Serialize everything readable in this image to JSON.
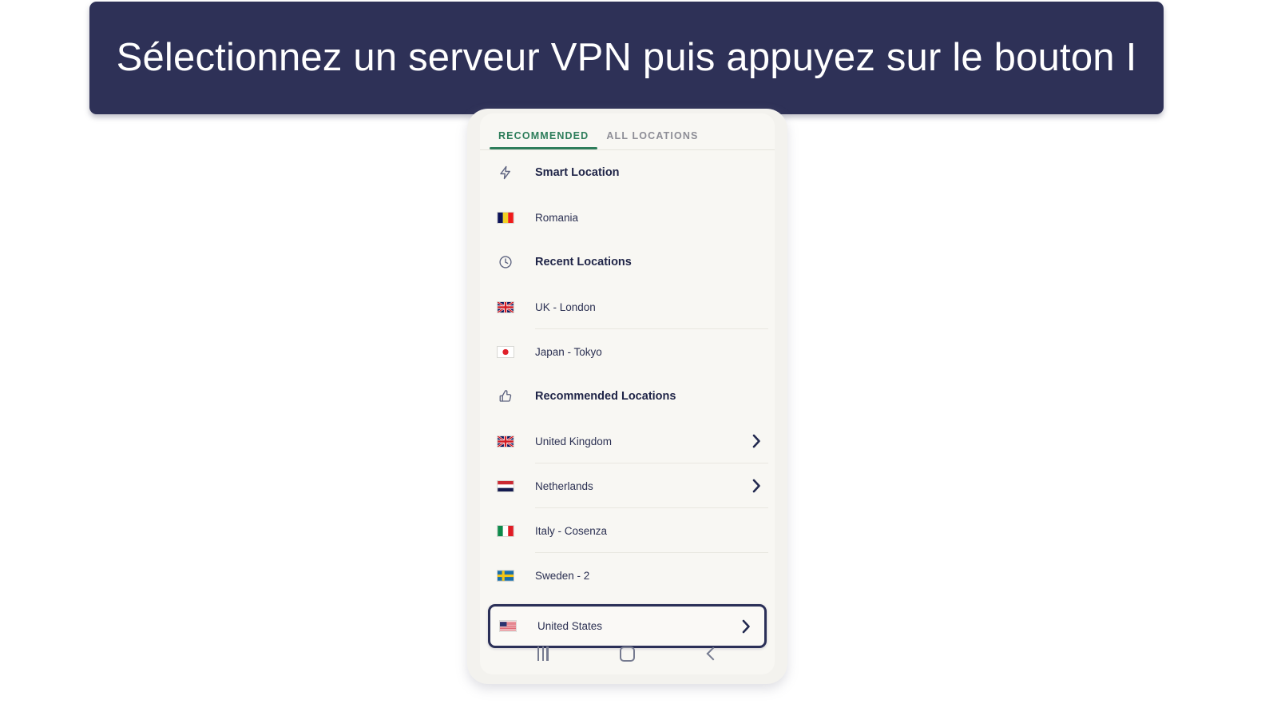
{
  "banner": {
    "text": "Sélectionnez un serveur VPN puis appuyez sur le bouton I",
    "background": "#2e3157",
    "text_color": "#ffffff"
  },
  "app": {
    "accent_green": "#2d7d5a",
    "screen_background": "#f8f7f3",
    "highlight_border": "#2b3058",
    "tabs": [
      {
        "label": "RECOMMENDED",
        "active": true
      },
      {
        "label": "ALL LOCATIONS",
        "active": false
      }
    ],
    "sections": [
      {
        "name": "smart-location",
        "icon": "lightning-bolt-icon",
        "header": "Smart Location",
        "rows": [
          {
            "label": "Romania",
            "flag": "romania-flag",
            "chevron": false,
            "divider": false,
            "selected": false
          }
        ]
      },
      {
        "name": "recent-locations",
        "icon": "clock-icon",
        "header": "Recent Locations",
        "rows": [
          {
            "label": "UK - London",
            "flag": "united-kingdom-flag",
            "chevron": false,
            "divider": true,
            "selected": false
          },
          {
            "label": "Japan - Tokyo",
            "flag": "japan-flag",
            "chevron": false,
            "divider": false,
            "selected": false
          }
        ]
      },
      {
        "name": "recommended-locations",
        "icon": "thumbs-up-icon",
        "header": "Recommended Locations",
        "rows": [
          {
            "label": "United Kingdom",
            "flag": "united-kingdom-flag",
            "chevron": true,
            "divider": true,
            "selected": false
          },
          {
            "label": "Netherlands",
            "flag": "netherlands-flag",
            "chevron": true,
            "divider": true,
            "selected": false
          },
          {
            "label": "Italy - Cosenza",
            "flag": "italy-flag",
            "chevron": false,
            "divider": true,
            "selected": false
          },
          {
            "label": "Sweden - 2",
            "flag": "sweden-flag",
            "chevron": false,
            "divider": false,
            "selected": false
          },
          {
            "label": "United States",
            "flag": "united-states-flag",
            "chevron": true,
            "divider": false,
            "selected": true
          }
        ]
      }
    ],
    "navbar": [
      {
        "name": "recents-button",
        "icon": "recents-icon"
      },
      {
        "name": "home-button",
        "icon": "home-icon"
      },
      {
        "name": "back-button",
        "icon": "back-icon"
      }
    ]
  }
}
